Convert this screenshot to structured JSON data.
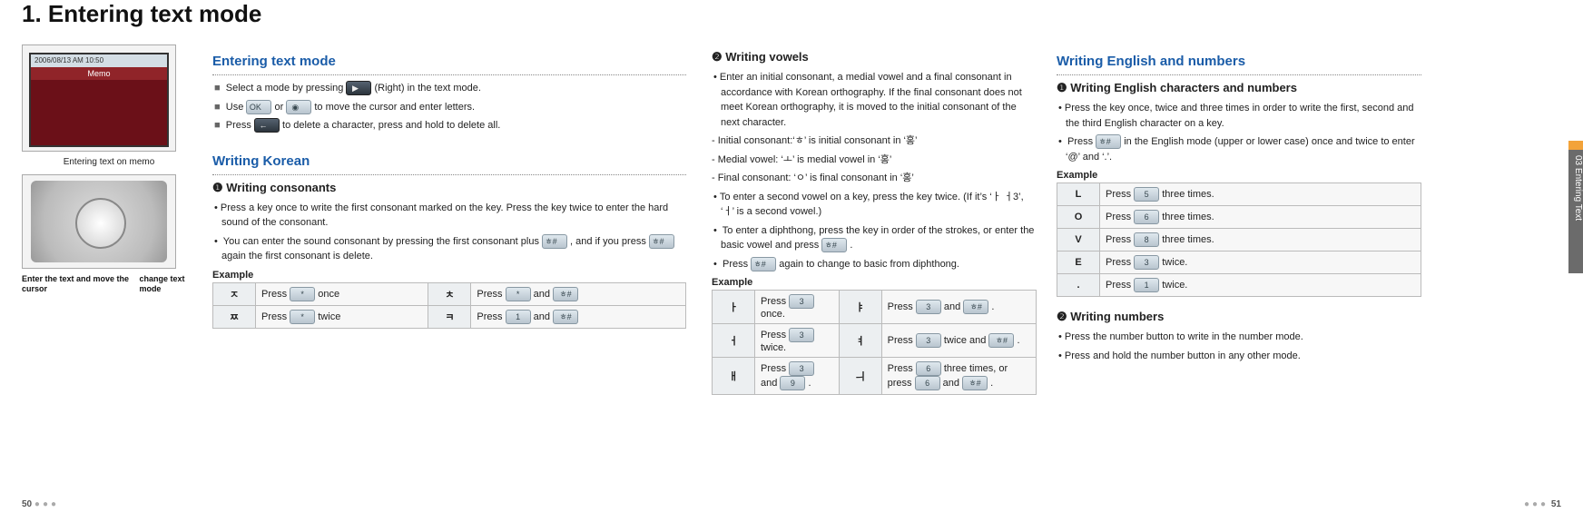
{
  "page": {
    "title": "1. Entering text mode",
    "left_page_num": "50",
    "right_page_num": "51",
    "side_tab": "03 Entering Text"
  },
  "fig": {
    "phone_timebar": "2006/08/13 AM 10:50",
    "phone_title": "Memo",
    "caption_memo": "Entering text on memo",
    "caption_dpad_left": "Enter the text and move the cursor",
    "caption_dpad_right": "change text mode"
  },
  "s_enter": {
    "heading": "Entering text mode",
    "l1a": "Select a mode by pressing ",
    "l1b": " (Right) in the text mode.",
    "key1": "▶",
    "l2a": "Use ",
    "l2b": " or ",
    "l2c": " to move the cursor and enter letters.",
    "key2a": "OK",
    "key2b": "◉",
    "l3a": "Press ",
    "l3b": " to delete a character, press and hold to delete all.",
    "key3": "←"
  },
  "s_korean": {
    "heading": "Writing Korean"
  },
  "s_cons": {
    "heading": "❶ Writing consonants",
    "p1": "Press a key once to write the first consonant marked on the key. Press the key twice to enter the hard sound of the consonant.",
    "p2a": "You can enter the sound consonant by pressing the first consonant plus ",
    "p2b": " , and if you press ",
    "p2c": " again the first consonant is delete.",
    "key_hash": "ㅎ#",
    "example_label": "Example",
    "r1c1": "ㅈ",
    "r1c2a": "Press ",
    "r1c2k": "*",
    "r1c2b": " once",
    "r1c3": "ㅊ",
    "r1c4a": "Press ",
    "r1c4k1": "*",
    "r1c4b": " and ",
    "r1c4k2": "ㅎ#",
    "r2c1": "ㅉ",
    "r2c2a": "Press ",
    "r2c2k": "*",
    "r2c2b": " twice",
    "r2c3": "ㅋ",
    "r2c4a": "Press ",
    "r2c4k1": "1",
    "r2c4b": " and ",
    "r2c4k2": "ㅎ#"
  },
  "s_vow": {
    "heading": "❷ Writing vowels",
    "p1": "Enter an initial consonant, a medial vowel and a final consonant in accordance with Korean orthography. If the final consonant does not meet Korean orthography, it is moved to the initial consonant of the next character.",
    "d1": "- Initial consonant:‘ㅎ’ is initial consonant in ‘홍’",
    "d2": "- Medial vowel: ‘ㅗ’ is medial vowel in ‘홍’",
    "d3": "- Final consonant: ‘ㅇ’ is final consonant in ‘홍’",
    "p2": "To enter a second vowel on a key, press the key twice. (If it’s ‘ㅏ ㅓ3’, ‘ㅓ’ is a second vowel.)",
    "p3a": "To enter a diphthong, press the key in order of the strokes, or enter the basic vowel and press ",
    "p3b": " .",
    "key_hash": "ㅎ#",
    "p4a": "Press ",
    "p4b": " again to change to basic from diphthong.",
    "example_label": "Example",
    "t": {
      "r1c1": "ㅏ",
      "r1c2a": "Press ",
      "r1c2k": "3",
      "r1c2b": " once.",
      "r1c3": "ㅑ",
      "r1c4a": "Press ",
      "r1c4k1": "3",
      "r1c4b": " and ",
      "r1c4k2": "ㅎ#",
      "r1c4c": " .",
      "r2c1": "ㅓ",
      "r2c2a": "Press ",
      "r2c2k": "3",
      "r2c2b": " twice.",
      "r2c3": "ㅕ",
      "r2c4a": "Press ",
      "r2c4k1": "3",
      "r2c4b": " twice and ",
      "r2c4k2": "ㅎ#",
      "r2c4c": " .",
      "r3c1": "ㅐ",
      "r3c2a": "Press ",
      "r3c2k1": "3",
      "r3c2b": " and ",
      "r3c2k2": "9",
      "r3c2c": " .",
      "r3c3": "ㅢ",
      "r3c4a": "Press ",
      "r3c4k1": "6",
      "r3c4b": " three times, or press ",
      "r3c4k2": "6",
      "r3c4c": " and ",
      "r3c4k3": "ㅎ#",
      "r3c4d": " ."
    }
  },
  "s_eng": {
    "heading": "Writing English and numbers",
    "sub1": "❶ Writing English characters and numbers",
    "p1": "Press the key once, twice and three times in order to write the first, second and the third English character on a key.",
    "p2a": "Press ",
    "p2b": " in the English mode (upper or lower case) once and twice to enter ‘@’ and ‘.’.",
    "key_hash": "ㅎ#",
    "example_label": "Example",
    "t": {
      "r1k": "L",
      "r1a": "Press ",
      "r1key": "5",
      "r1b": " three times.",
      "r2k": "O",
      "r2a": "Press ",
      "r2key": "6",
      "r2b": " three times.",
      "r3k": "V",
      "r3a": "Press ",
      "r3key": "8",
      "r3b": " three times.",
      "r4k": "E",
      "r4a": "Press ",
      "r4key": "3",
      "r4b": " twice.",
      "r5k": ".",
      "r5a": "Press ",
      "r5key": "1",
      "r5b": " twice."
    },
    "sub2": "❷ Writing numbers",
    "n1": "Press the number button to write in the number mode.",
    "n2": "Press and hold the number button in any other mode."
  }
}
